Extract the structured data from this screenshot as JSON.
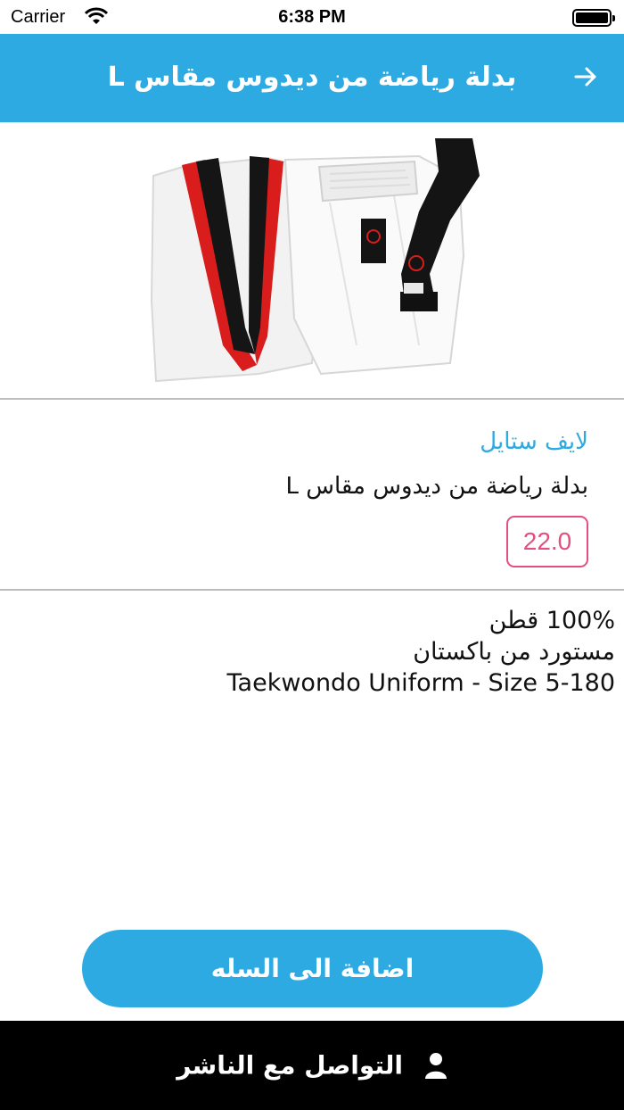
{
  "status_bar": {
    "carrier": "Carrier",
    "time": "6:38 PM"
  },
  "nav": {
    "title": "بدلة رياضة من ديدوس مقاس L",
    "back_icon": "arrow-right-icon"
  },
  "product": {
    "image_alt": "taekwondo-uniform-photo",
    "brand": "لايف ستايل",
    "name": "بدلة رياضة من ديدوس مقاس L",
    "price": "22.0",
    "description": [
      "100% قطن",
      "مستورد من باكستان",
      "Taekwondo Uniform - Size 5-180"
    ]
  },
  "actions": {
    "add_to_cart": "اضافة الى السله",
    "contact_publisher": "التواصل مع الناشر"
  },
  "colors": {
    "accent": "#2eaae2",
    "price": "#e44f7e",
    "footer": "#000000"
  }
}
